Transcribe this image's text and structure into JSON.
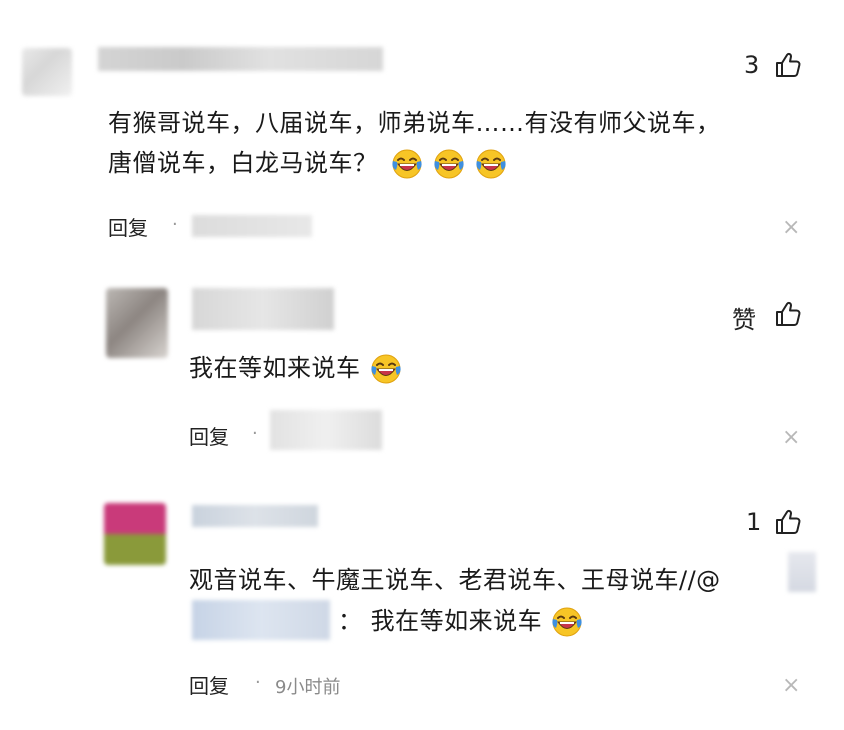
{
  "comments": [
    {
      "like_count": "3",
      "text_line1": "有猴哥说车，八届说车，师弟说车……有没有师父说车，",
      "text_line2": "唐僧说车，白龙马说车？",
      "reply_label": "回复",
      "separator": "·"
    },
    {
      "like_count": "赞",
      "text": "我在等如来说车",
      "reply_label": "回复",
      "separator": "·"
    },
    {
      "like_count": "1",
      "text_line1": "观音说车、牛魔王说车、老君说车、王母说车//@",
      "quote_sep": "：",
      "quote_text": "我在等如来说车",
      "reply_label": "回复",
      "separator": "·",
      "time": "9小时前"
    }
  ],
  "icons": {
    "like": "thumbs-up-icon",
    "close": "close-icon",
    "emoji": "laughing-tears-emoji"
  },
  "colors": {
    "emoji_yellow": "#F7C526",
    "emoji_mouth": "#C7344A",
    "tear_blue": "#3E8FE0"
  }
}
